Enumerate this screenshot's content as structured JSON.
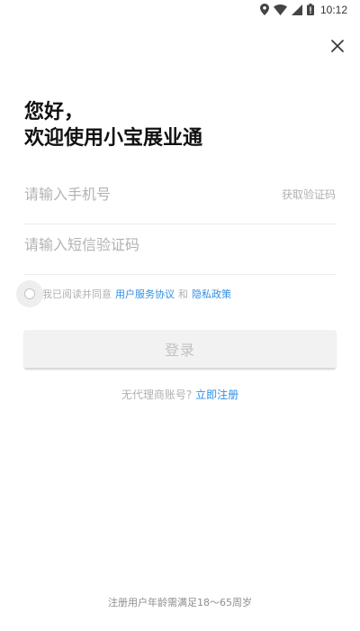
{
  "status_bar": {
    "time": "10:12",
    "icons": [
      "location-icon",
      "wifi-icon",
      "signal-icon",
      "battery-icon"
    ]
  },
  "header": {
    "close_icon": "close-icon"
  },
  "greeting": {
    "line1": "您好，",
    "line2": "欢迎使用小宝展业通"
  },
  "form": {
    "phone_placeholder": "请输入手机号",
    "phone_value": "",
    "get_code_label": "获取验证码",
    "code_placeholder": "请输入短信验证码",
    "code_value": ""
  },
  "agreement": {
    "checked": false,
    "prefix": "我已阅读并同意",
    "service_link": "用户服务协议",
    "and": "和",
    "privacy_link": "隐私政策"
  },
  "login_button": {
    "label": "登录"
  },
  "register": {
    "hint": "无代理商账号?",
    "link": "立即注册"
  },
  "footer": {
    "note": "注册用户年龄需满足18～65周岁"
  },
  "colors": {
    "accent": "#2f8fe6",
    "muted_text": "#b0b0b0",
    "button_bg": "#f2f2f2"
  }
}
